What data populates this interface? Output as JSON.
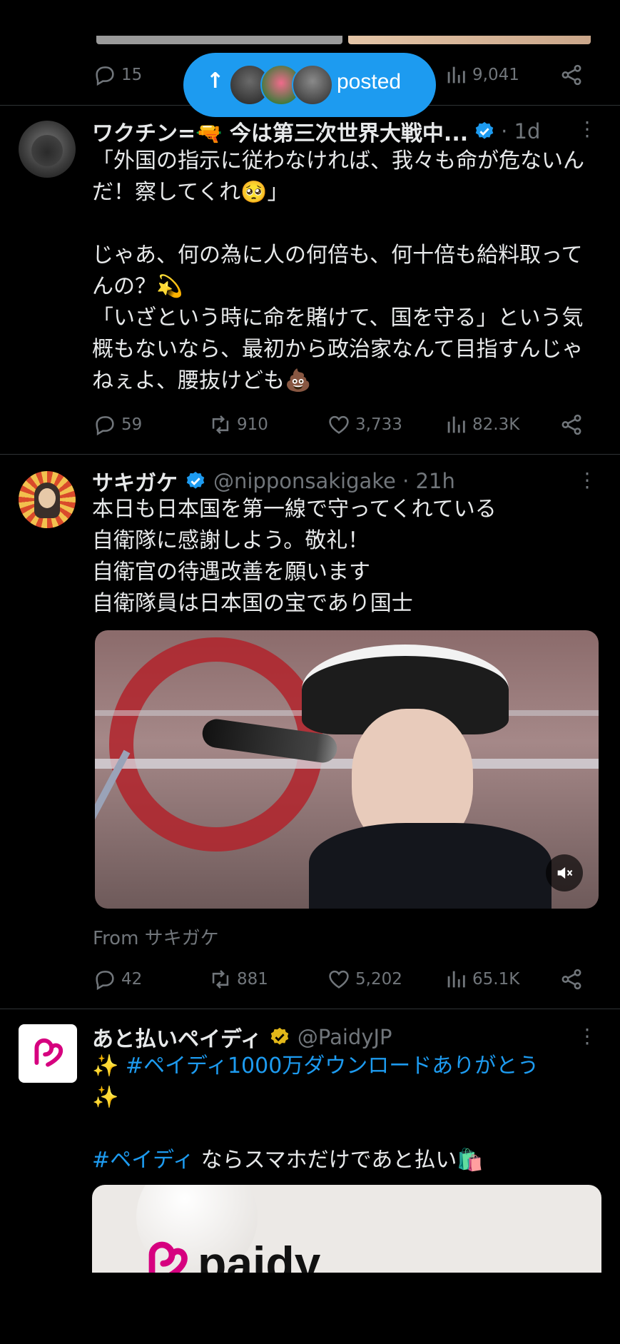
{
  "top_tweet": {
    "replies": "15",
    "views": "9,041"
  },
  "posted_pill": {
    "label": "posted",
    "arrow": "↑"
  },
  "tweet1": {
    "name": "ワクチン=🔫 今は第三次世界大戦中...",
    "time": "· 1d",
    "text": "「外国の指示に従わなければ、我々も命が危ないんだ！察してくれ🥺」\n\nじゃあ、何の為に人の何倍も、何十倍も給料取ってんの？💫\n「いざという時に命を賭けて、国を守る」という気概もないなら、最初から政治家なんて目指すんじゃねぇよ、腰抜けども💩",
    "replies": "59",
    "reposts": "910",
    "likes": "3,733",
    "views": "82.3K"
  },
  "tweet2": {
    "name": "サキガケ",
    "handle": "@nipponsakigake · 21h",
    "text": "本日も日本国を第一線で守ってくれている\n自衛隊に感謝しよう。敬礼！\n自衛官の待遇改善を願います\n自衛隊員は日本国の宝であり国士",
    "from_label": "From サキガケ",
    "replies": "42",
    "reposts": "881",
    "likes": "5,202",
    "views": "65.1K"
  },
  "tweet3": {
    "name": "あと払いペイディ",
    "handle": "@PaidyJP",
    "line1_sparkle": "✨",
    "hashtag1": "#ペイディ1000万ダウンロードありがとう",
    "line2_sparkle": "✨",
    "hashtag2": "#ペイディ",
    "line3_rest": " ならスマホだけであと払い🛍️",
    "card_logo_text": "paidy"
  },
  "colors": {
    "accent": "#1d9bf0",
    "verified_gold": "#e2b719",
    "paidy_pink": "#d6007f"
  }
}
